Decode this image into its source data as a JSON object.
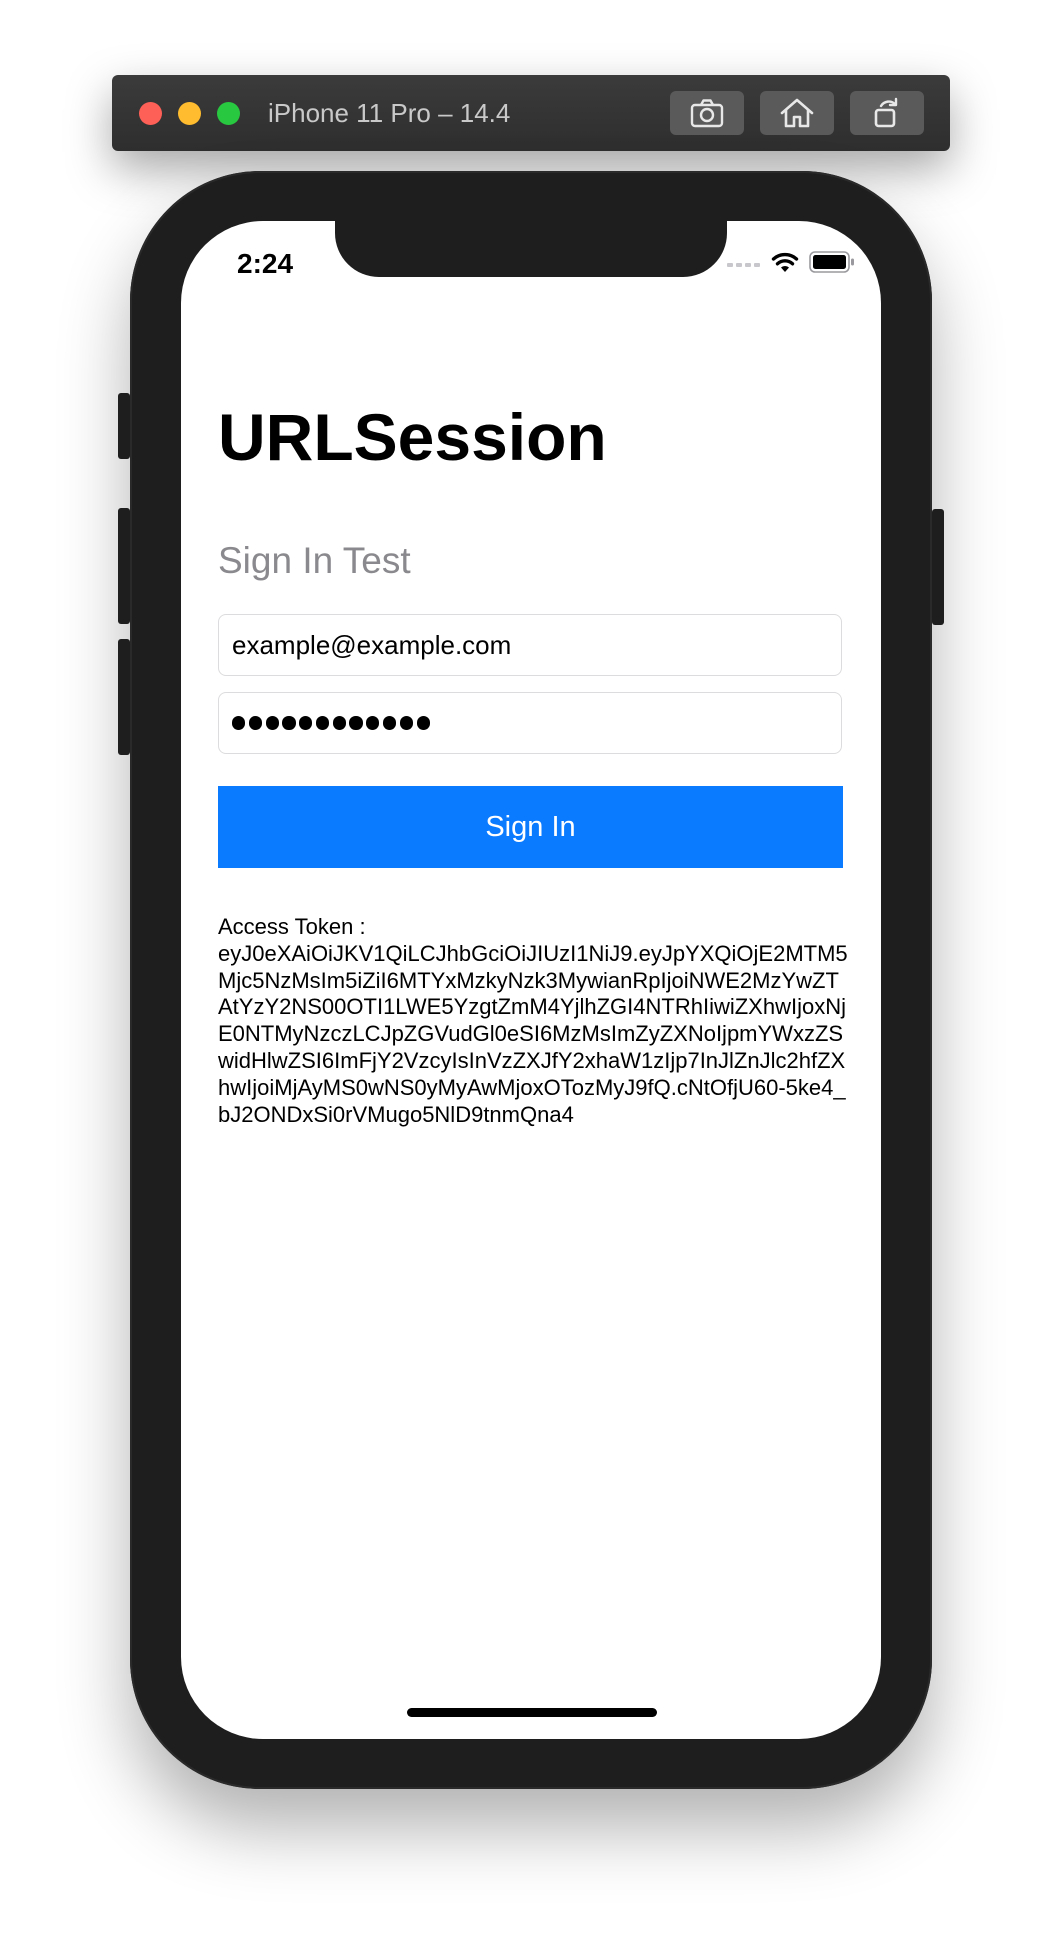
{
  "simulator": {
    "title": "iPhone 11 Pro – 14.4",
    "buttons": [
      "screenshot",
      "home",
      "rotate"
    ]
  },
  "status_bar": {
    "time": "2:24",
    "icons": [
      "cellular-icon",
      "wifi-icon",
      "battery-icon"
    ]
  },
  "app": {
    "title": "URLSession",
    "section_title": "Sign In Test",
    "email_value": "example@example.com",
    "password_mask_length": 12,
    "sign_in_label": "Sign In",
    "token_label": "Access Token :",
    "token_value": "eyJ0eXAiOiJKV1QiLCJhbGciOiJIUzI1NiJ9.eyJpYXQiOjE2MTM5Mjc5NzMsIm5iZiI6MTYxMzkyNzk3MywianRpIjoiNWE2MzYwZTAtYzY2NS00OTI1LWE5YzgtZmM4YjlhZGI4NTRhIiwiZXhwIjoxNjE0NTMyNzczLCJpZGVudGl0eSI6MzMsImZyZXNoIjpmYWxzZSwidHlwZSI6ImFjY2VzcyIsInVzZXJfY2xhaW1zIjp7InJlZnJlc2hfZXhwIjoiMjAyMS0wNS0yMyAwMjoxOTozMyJ9fQ.cNtOfjU60-5ke4_bJ2ONDxSi0rVMugo5NlD9tnmQna4"
  },
  "colors": {
    "accent": "#0a7aff",
    "secondary_text": "#8a8a8e",
    "device_frame": "#1e1e1e"
  }
}
